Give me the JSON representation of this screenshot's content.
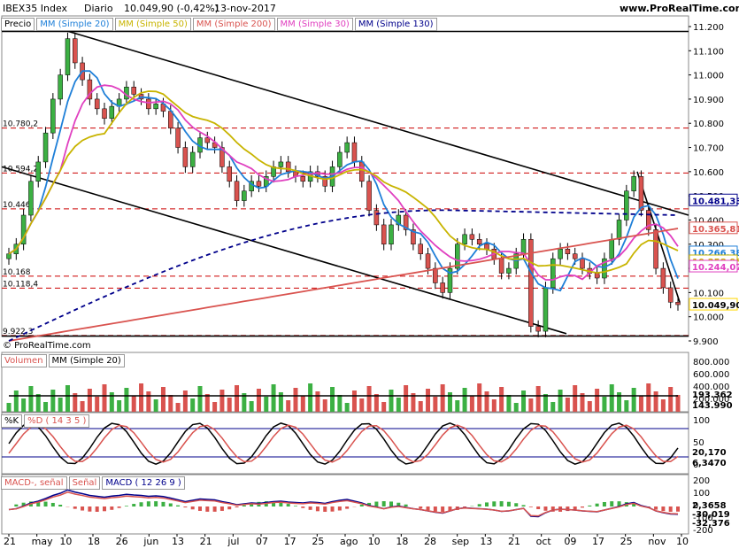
{
  "header": {
    "instrument": "IBEX35 Index",
    "period": "Diario",
    "last": "10.049,90 (-0,42%)",
    "date": "13-nov-2017",
    "site": "www.ProRealTime.com"
  },
  "price_pane": {
    "legend": [
      "Precio",
      "MM (Simple 20)",
      "MM (Simple 50)",
      "MM (Simple 200)",
      "MM (Simple 30)",
      "MM (Simple 130)"
    ],
    "legend_colors": [
      "#000000",
      "#1e7fd8",
      "#c8b400",
      "#d9534f",
      "#e040c0",
      "#00008b"
    ],
    "y_ticks": [
      "11.200",
      "11.100",
      "11.000",
      "10.900",
      "10.800",
      "10.700",
      "10.600",
      "10.500",
      "10.400",
      "10.300",
      "10.200",
      "10.100",
      "10.000",
      "9.900"
    ],
    "level_labels": [
      "10.780,2",
      "10.594,2",
      "10.446",
      "10.168",
      "10.118,4",
      "9.922,3"
    ],
    "badges": [
      {
        "text": "10.481,33",
        "color": "#00008b"
      },
      {
        "text": "10.365,81",
        "color": "#d9534f"
      },
      {
        "text": "10.266,38",
        "color": "#1e7fd8"
      },
      {
        "text": "10.258,95",
        "color": "#c8b400"
      },
      {
        "text": "10.244,07",
        "color": "#e040c0"
      },
      {
        "text": "10.049,90",
        "color": "#ffd700"
      }
    ],
    "copyright": "© ProRealTime.com"
  },
  "volume_pane": {
    "legend": [
      "Volumen",
      "MM (Simple 20)"
    ],
    "y_ticks": [
      "800.000",
      "600.000",
      "400.000",
      "200.000"
    ],
    "badges": [
      "193.362",
      "143.990"
    ]
  },
  "stoch_pane": {
    "legend": [
      "%K",
      "%D ( 14 3 5 )"
    ],
    "y_ticks": [
      "100",
      "50",
      "0"
    ],
    "badges": [
      "20,170",
      "6,3470"
    ]
  },
  "macd_pane": {
    "legend": [
      "MACD-, señal",
      "Señal",
      "MACD ( 12 26 9 )"
    ],
    "y_ticks": [
      "200",
      "100",
      "0",
      "-100",
      "-200"
    ],
    "badges": [
      "2,3658",
      "-30,019",
      "-32,376"
    ]
  },
  "x_axis": {
    "labels": [
      "21",
      "may",
      "10",
      "18",
      "26",
      "jun",
      "13",
      "21",
      "jul",
      "07",
      "17",
      "25",
      "ago",
      "10",
      "18",
      "28",
      "sep",
      "13",
      "21",
      "oct",
      "09",
      "17",
      "25",
      "nov",
      "10"
    ]
  },
  "chart_data": {
    "type": "candlestick",
    "title": "IBEX35 Index",
    "ylim": [
      9900,
      11200
    ],
    "support_levels": [
      10780.2,
      10594.2,
      10446,
      10168,
      10118.4,
      9922.3
    ],
    "close_path": [
      10260,
      10300,
      10420,
      10560,
      10640,
      10760,
      10900,
      11000,
      11150,
      11050,
      10980,
      10900,
      10860,
      10820,
      10870,
      10900,
      10950,
      10920,
      10900,
      10860,
      10880,
      10850,
      10780,
      10700,
      10620,
      10680,
      10740,
      10720,
      10700,
      10620,
      10560,
      10480,
      10520,
      10560,
      10540,
      10580,
      10620,
      10640,
      10600,
      10580,
      10560,
      10600,
      10580,
      10540,
      10620,
      10680,
      10720,
      10640,
      10560,
      10440,
      10380,
      10300,
      10380,
      10420,
      10360,
      10300,
      10260,
      10200,
      10140,
      10100,
      10200,
      10300,
      10340,
      10320,
      10300,
      10280,
      10240,
      10180,
      10200,
      10260,
      10320,
      9960,
      9940,
      10120,
      10240,
      10280,
      10260,
      10240,
      10200,
      10180,
      10160,
      10240,
      10320,
      10400,
      10520,
      10580,
      10440,
      10360,
      10200,
      10120,
      10060,
      10050
    ]
  }
}
